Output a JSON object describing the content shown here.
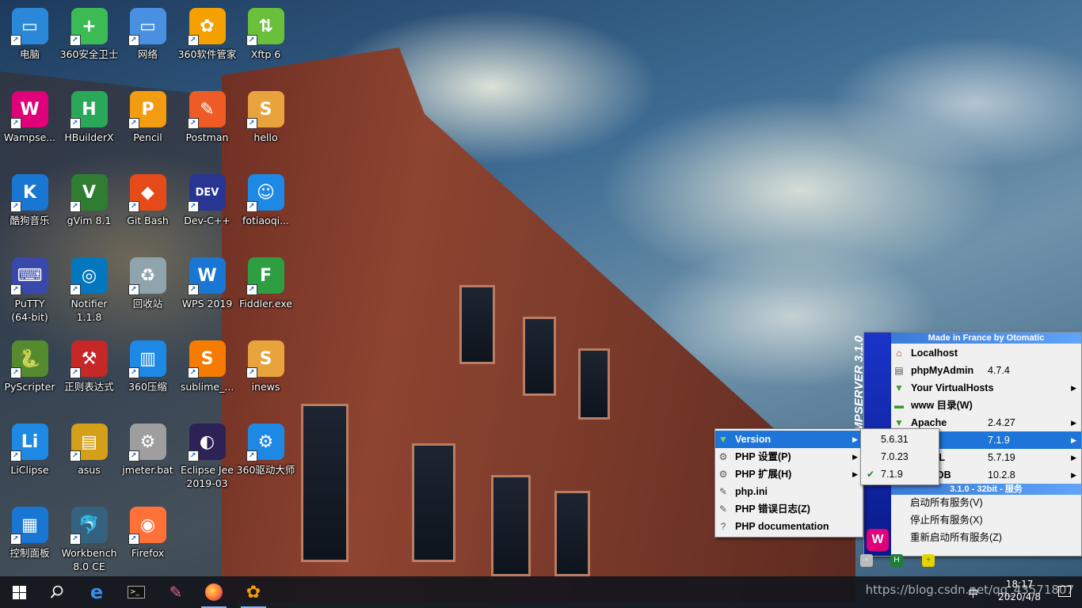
{
  "desktop": {
    "icons": [
      {
        "label": "电脑",
        "glyph": "▭",
        "color": "#2b88d8"
      },
      {
        "label": "360安全卫士",
        "glyph": "+",
        "color": "#3cba54"
      },
      {
        "label": "网络",
        "glyph": "▭",
        "color": "#4a90e2"
      },
      {
        "label": "360软件管家",
        "glyph": "✿",
        "color": "#f4a100"
      },
      {
        "label": "Xftp 6",
        "glyph": "⇅",
        "color": "#6abf3b"
      },
      {
        "label": "Wampse...",
        "glyph": "W",
        "color": "#e0007a"
      },
      {
        "label": "HBuilderX",
        "glyph": "H",
        "color": "#2aa85a"
      },
      {
        "label": "Pencil",
        "glyph": "P",
        "color": "#f39c12"
      },
      {
        "label": "Postman",
        "glyph": "✎",
        "color": "#ef5b25"
      },
      {
        "label": "hello",
        "glyph": "S",
        "color": "#e8a33c"
      },
      {
        "label": "酷狗音乐",
        "glyph": "K",
        "color": "#1976d2"
      },
      {
        "label": "gVim 8.1",
        "glyph": "V",
        "color": "#2e7d32"
      },
      {
        "label": "Git Bash",
        "glyph": "◆",
        "color": "#e64a19"
      },
      {
        "label": "Dev-C++",
        "glyph": "DEV",
        "color": "#283593"
      },
      {
        "label": "fotiaoqi...",
        "glyph": "☺",
        "color": "#1e88e5"
      },
      {
        "label": "PuTTY\n(64-bit)",
        "glyph": "⌨",
        "color": "#3949ab"
      },
      {
        "label": "Notifier\n1.1.8",
        "glyph": "◎",
        "color": "#0277bd"
      },
      {
        "label": "回收站",
        "glyph": "♻",
        "color": "#90a4ae"
      },
      {
        "label": "WPS 2019",
        "glyph": "W",
        "color": "#1976d2"
      },
      {
        "label": "Fiddler.exe",
        "glyph": "F",
        "color": "#2e9e43"
      },
      {
        "label": "PyScripter",
        "glyph": "🐍",
        "color": "#558b2f"
      },
      {
        "label": "正则表达式",
        "glyph": "⚒",
        "color": "#c62828"
      },
      {
        "label": "360压缩",
        "glyph": "▥",
        "color": "#1e88e5"
      },
      {
        "label": "sublime_...",
        "glyph": "S",
        "color": "#f57c00"
      },
      {
        "label": "inews",
        "glyph": "S",
        "color": "#e8a33c"
      },
      {
        "label": "LiClipse",
        "glyph": "Li",
        "color": "#1e88e5"
      },
      {
        "label": "asus",
        "glyph": "▤",
        "color": "#d4a017"
      },
      {
        "label": "jmeter.bat",
        "glyph": "⚙",
        "color": "#9e9e9e"
      },
      {
        "label": "Eclipse Jee\n2019-03",
        "glyph": "◐",
        "color": "#2c2255"
      },
      {
        "label": "360驱动大师",
        "glyph": "⚙",
        "color": "#1e88e5"
      },
      {
        "label": "控制面板",
        "glyph": "▦",
        "color": "#1976d2"
      },
      {
        "label": "Workbench\n8.0 CE",
        "glyph": "🐬",
        "color": "#34627f"
      },
      {
        "label": "Firefox",
        "glyph": "◉",
        "color": "#ff7139"
      }
    ]
  },
  "wamp_menu": {
    "header_top": "Made in France by Otomatic",
    "strip_text": "WAMPSERVER 3.1.0",
    "logo": "W",
    "items": [
      {
        "icon": "house-icon",
        "glyph": "⌂",
        "label": "Localhost",
        "value": "",
        "arrow": ""
      },
      {
        "icon": "table-icon",
        "glyph": "▤",
        "label": "phpMyAdmin",
        "value": "4.7.4",
        "arrow": ""
      },
      {
        "icon": "folder-icon",
        "glyph": "▼",
        "label": "Your VirtualHosts",
        "value": "",
        "arrow": "▶"
      },
      {
        "icon": "folder-icon",
        "glyph": "▬",
        "label": "www 目录(W)",
        "value": "",
        "arrow": ""
      },
      {
        "icon": "folder-icon",
        "glyph": "▼",
        "label": "Apache",
        "value": "2.4.27",
        "arrow": "▶"
      },
      {
        "icon": "folder-icon",
        "glyph": "▼",
        "label": "PHP",
        "value": "7.1.9",
        "arrow": "▶"
      },
      {
        "icon": "folder-icon",
        "glyph": "▼",
        "label": "MySQL",
        "value": "5.7.19",
        "arrow": "▶"
      },
      {
        "icon": "folder-icon",
        "glyph": "▼",
        "label": "MariaDB",
        "value": "10.2.8",
        "arrow": "▶"
      }
    ],
    "header_service": "3.1.0 - 32bit - 服务",
    "service_items": [
      "启动所有服务(V)",
      "停止所有服务(X)",
      "重新启动所有服务(Z)"
    ]
  },
  "php_menu": {
    "items": [
      {
        "icon": "folder-icon",
        "glyph": "▼",
        "label": "Version",
        "arrow": "▶",
        "highlight": true
      },
      {
        "icon": "gear-icon",
        "glyph": "⚙",
        "label": "PHP 设置(P)",
        "arrow": "▶",
        "highlight": false
      },
      {
        "icon": "gear-icon",
        "glyph": "⚙",
        "label": "PHP 扩展(H)",
        "arrow": "▶",
        "highlight": false
      },
      {
        "icon": "file-edit-icon",
        "glyph": "✎",
        "label": "php.ini",
        "arrow": "",
        "highlight": false
      },
      {
        "icon": "file-edit-icon",
        "glyph": "✎",
        "label": "PHP 错误日志(Z)",
        "arrow": "",
        "highlight": false
      },
      {
        "icon": "help-book-icon",
        "glyph": "?",
        "label": "PHP documentation",
        "arrow": "",
        "highlight": false
      }
    ]
  },
  "version_menu": {
    "items": [
      {
        "label": "5.6.31",
        "checked": false
      },
      {
        "label": "7.0.23",
        "checked": false
      },
      {
        "label": "7.1.9",
        "checked": true
      }
    ]
  },
  "taskbar": {
    "clock_time": "18:17",
    "clock_date": "2020/4/8",
    "watermark": "https://blog.csdn.net/qq_43571807",
    "ime": "中"
  }
}
